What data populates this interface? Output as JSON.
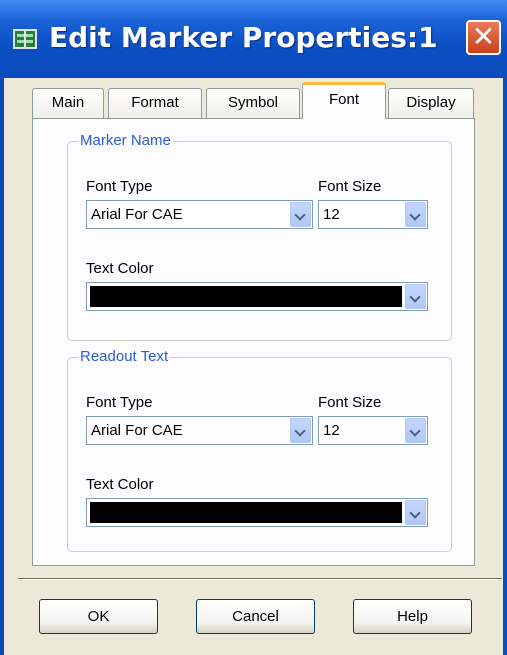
{
  "window": {
    "title": "Edit Marker Properties:1",
    "title_icon": "grid-icon",
    "close_symbol": "✕"
  },
  "tabs": [
    {
      "label": "Main",
      "active": false
    },
    {
      "label": "Format",
      "active": false
    },
    {
      "label": "Symbol",
      "active": false
    },
    {
      "label": "Font",
      "active": true
    },
    {
      "label": "Display",
      "active": false
    }
  ],
  "marker_name": {
    "group_title": "Marker Name",
    "font_type_label": "Font Type",
    "font_type_value": "Arial For CAE",
    "font_size_label": "Font Size",
    "font_size_value": "12",
    "text_color_label": "Text Color",
    "text_color_value": "#000000"
  },
  "readout_text": {
    "group_title": "Readout Text",
    "font_type_label": "Font Type",
    "font_type_value": "Arial For CAE",
    "font_size_label": "Font Size",
    "font_size_value": "12",
    "text_color_label": "Text Color",
    "text_color_value": "#000000"
  },
  "buttons": {
    "ok": "OK",
    "cancel": "Cancel",
    "help": "Help"
  },
  "colors": {
    "titlebar": "#0b4bbd",
    "group_title": "#2a5ecf",
    "active_tab_accent": "#f6b93c"
  }
}
